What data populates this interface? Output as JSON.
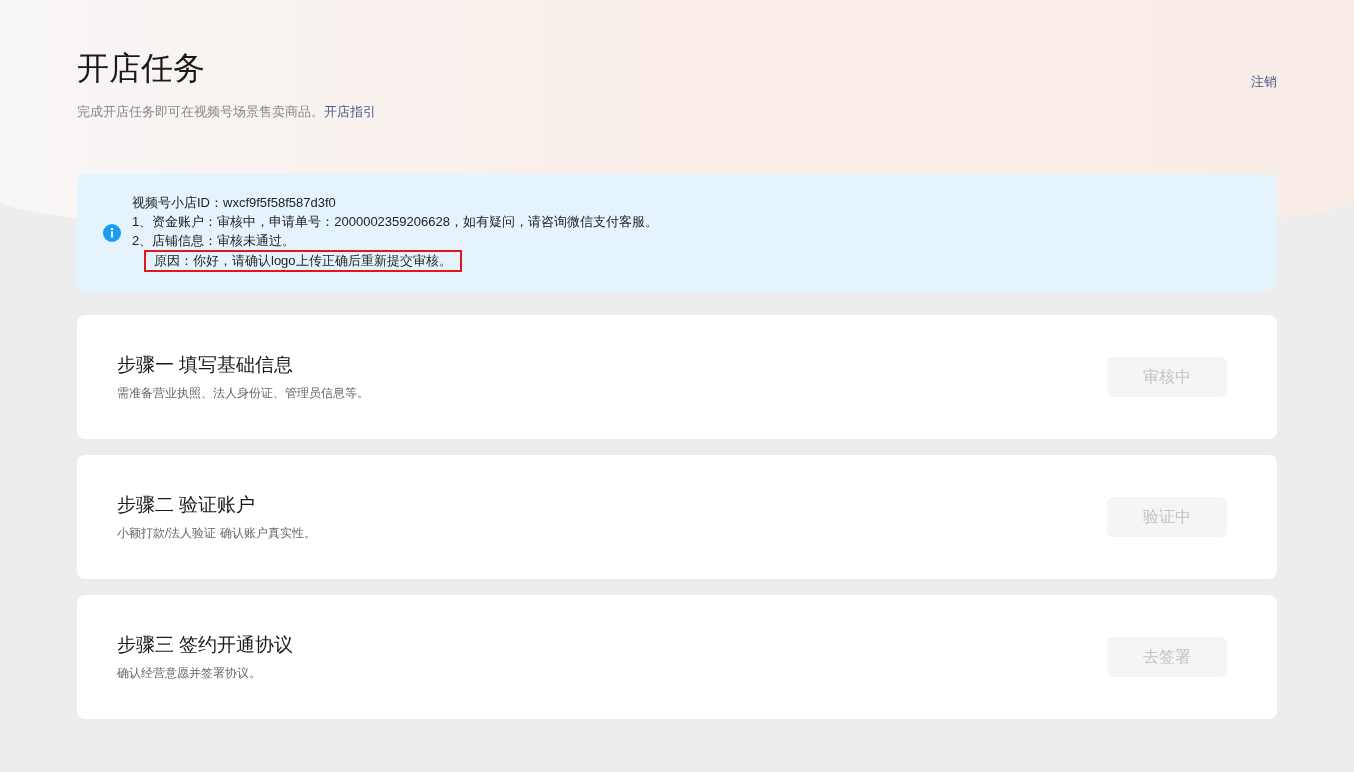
{
  "header": {
    "title": "开店任务",
    "subtitle": "完成开店任务即可在视频号场景售卖商品。",
    "guide_link": "开店指引",
    "logout": "注销"
  },
  "notice": {
    "lines": [
      {
        "text": "视频号小店ID：wxcf9f5f58f587d3f0",
        "highlighted": false,
        "indented": false
      },
      {
        "text": "1、资金账户：审核中，申请单号：2000002359206628，如有疑问，请咨询微信支付客服。",
        "highlighted": false,
        "indented": false
      },
      {
        "text": "2、店铺信息：审核未通过。",
        "highlighted": false,
        "indented": false
      },
      {
        "text": "原因：你好，请确认logo上传正确后重新提交审核。",
        "highlighted": true,
        "indented": true
      }
    ]
  },
  "steps": [
    {
      "title": "步骤一 填写基础信息",
      "description": "需准备营业执照、法人身份证、管理员信息等。",
      "button": "审核中",
      "disabled": true
    },
    {
      "title": "步骤二 验证账户",
      "description": "小额打款/法人验证 确认账户真实性。",
      "button": "验证中",
      "disabled": true
    },
    {
      "title": "步骤三 签约开通协议",
      "description": "确认经营意愿并签署协议。",
      "button": "去签署",
      "disabled": true
    }
  ]
}
